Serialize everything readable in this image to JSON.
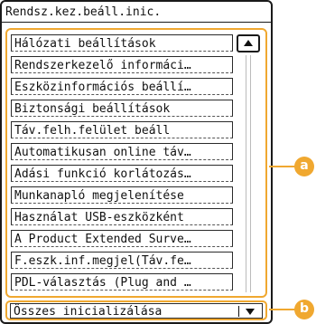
{
  "title": "Rendsz.kez.beáll.inic.",
  "list_items": [
    "Hálózati beállítások",
    "Rendszerkezelő informáci…",
    "Eszközinformációs beállí…",
    "Biztonsági beállítások",
    "Táv.felh.felület beáll",
    "Automatikusan online táv…",
    "Adási funkció korlátozás…",
    "Munkanapló megjelenítése",
    "Használat USB-eszközként",
    "A Product Extended Surve…",
    "F.eszk.inf.megjel(Táv.fe…",
    "PDL-választás (Plug and …"
  ],
  "bottom_select": "Összes inicializálása",
  "icons": {
    "scroll_up": "triangle-up-icon",
    "dropdown": "triangle-down-icon"
  },
  "callouts": {
    "a": "a",
    "b": "b"
  },
  "colors": {
    "highlight": "#f0a830",
    "border": "#1a1a1a"
  }
}
